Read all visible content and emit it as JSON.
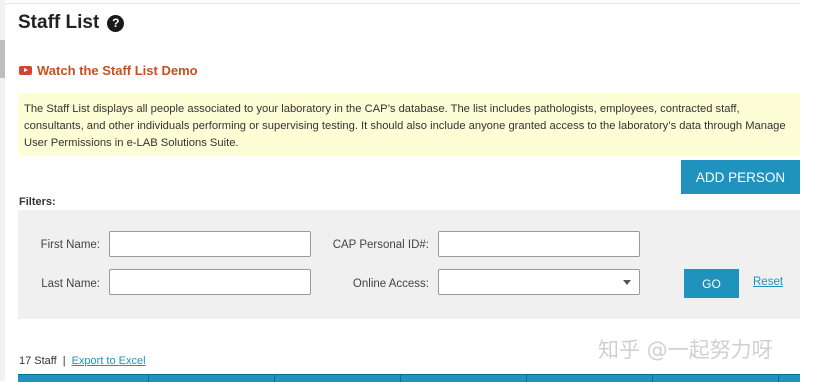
{
  "header": {
    "title": "Staff List",
    "help_icon": "question-circle-icon"
  },
  "demo": {
    "label": "Watch the Staff List Demo",
    "icon": "video-play-icon",
    "color": "#c8501e"
  },
  "info": {
    "text": "The Staff List displays all people associated to your laboratory in the CAP’s database. The list includes pathologists, employees, contracted staff, consultants, and other individuals performing or supervising testing. It should also include anyone granted access to the laboratory’s data through Manage User Permissions in e-LAB Solutions Suite.",
    "background": "#fdfdd6"
  },
  "actions": {
    "add_person_label": "ADD PERSON",
    "accent": "#1f93bd"
  },
  "filters": {
    "heading": "Filters:",
    "first_name_label": "First Name:",
    "first_name_value": "",
    "last_name_label": "Last Name:",
    "last_name_value": "",
    "cap_id_label": "CAP Personal ID#:",
    "cap_id_value": "",
    "online_access_label": "Online Access:",
    "online_access_value": "",
    "go_label": "GO",
    "reset_label": "Reset"
  },
  "results": {
    "count_text": "17 Staff",
    "separator": "|",
    "export_label": "Export to Excel"
  },
  "watermark": "知乎 @一起努力呀"
}
